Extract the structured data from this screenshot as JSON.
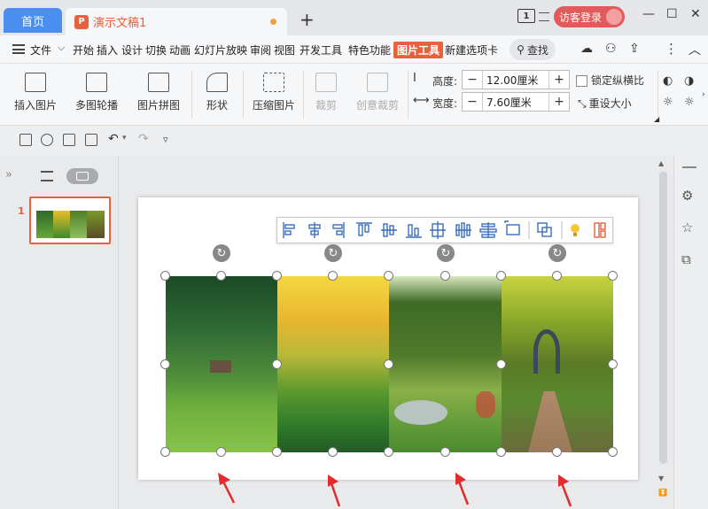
{
  "tabs": {
    "home": "首页",
    "doc": "演示文稿1",
    "new_tab": "+"
  },
  "titlebar": {
    "window_count": "1",
    "login": "访客登录",
    "minimize": "—",
    "maximize": "☐",
    "close": "✕"
  },
  "menu": {
    "file": "文件",
    "items": [
      "开始",
      "插入",
      "设计",
      "切换",
      "动画",
      "幻灯片放映",
      "审阅",
      "视图",
      "开发工具",
      "特色功能"
    ],
    "active": "图片工具",
    "after": "新建选项卡",
    "search": "查找"
  },
  "ribbon": {
    "insert_picture": "插入图片",
    "multi_outline": "多图轮播",
    "picture_collage": "图片拼图",
    "shape": "形状",
    "compress": "压缩图片",
    "crop": "裁剪",
    "creative_crop": "创意裁剪",
    "height_label": "高度:",
    "height_value": "12.00厘米",
    "width_label": "宽度:",
    "width_value": "7.60厘米",
    "lock_ratio": "锁定纵横比",
    "reset_size": "重设大小"
  },
  "slide_panel": {
    "slide_number": "1"
  },
  "colors": {
    "accent": "#e8603c",
    "home_tab": "#4a8ff0",
    "login": "#e25a5a"
  }
}
